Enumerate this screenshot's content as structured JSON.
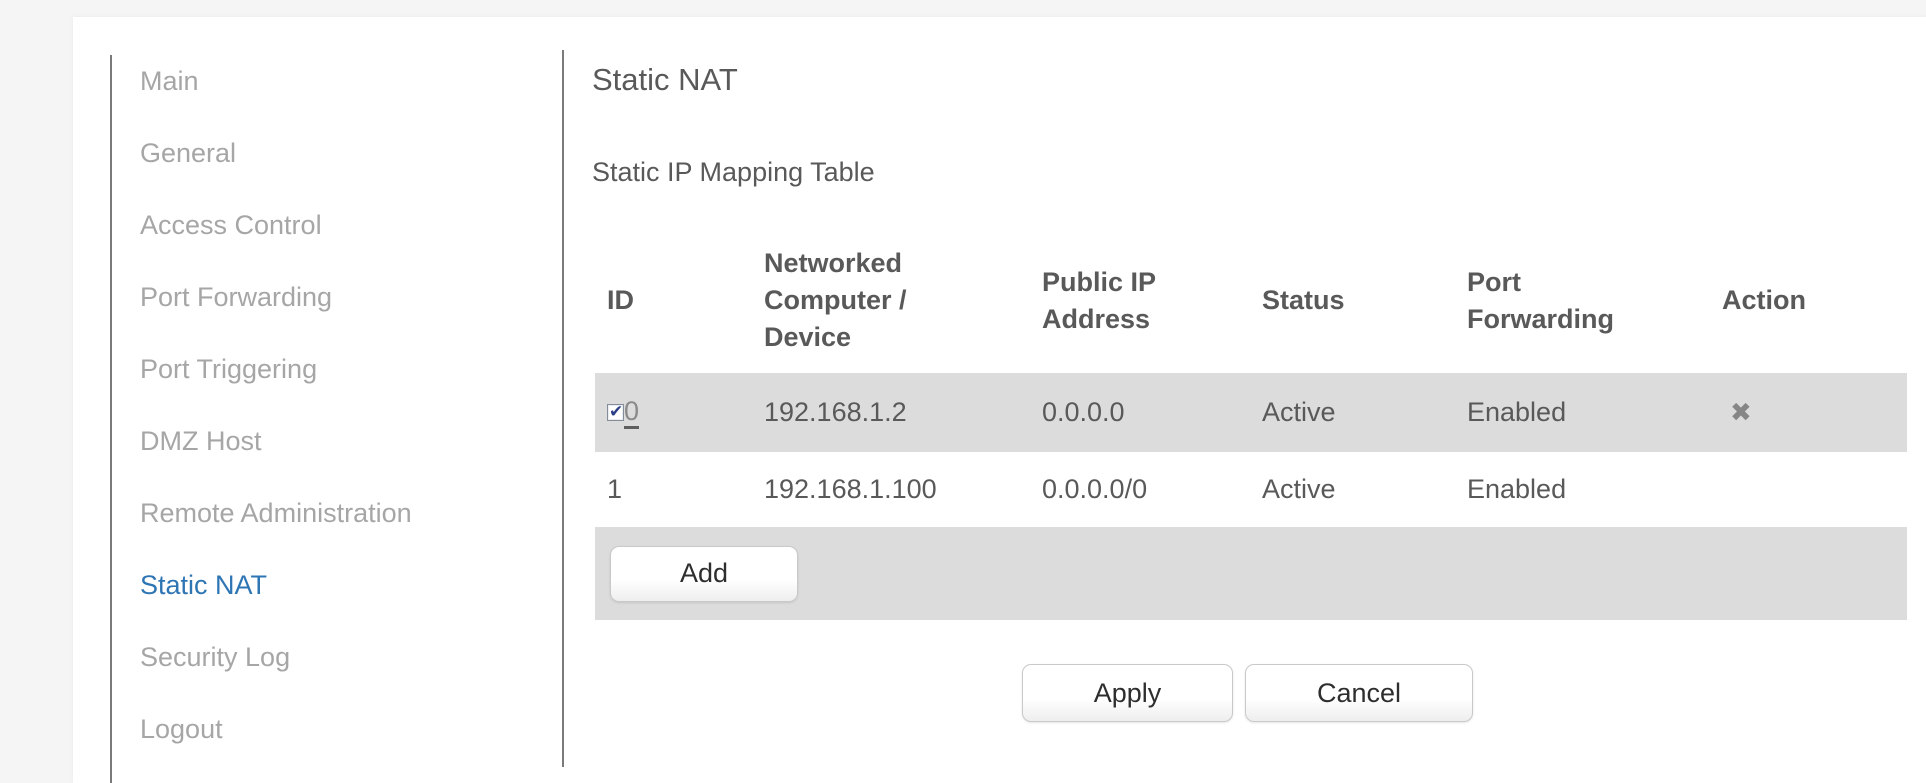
{
  "page": {
    "title": "Static NAT",
    "subtitle": "Static IP Mapping Table"
  },
  "sidebar": {
    "items": [
      {
        "label": "Main",
        "active": false
      },
      {
        "label": "General",
        "active": false
      },
      {
        "label": "Access Control",
        "active": false
      },
      {
        "label": "Port Forwarding",
        "active": false
      },
      {
        "label": "Port Triggering",
        "active": false
      },
      {
        "label": "DMZ Host",
        "active": false
      },
      {
        "label": "Remote Administration",
        "active": false
      },
      {
        "label": "Static NAT",
        "active": true
      },
      {
        "label": "Security Log",
        "active": false
      },
      {
        "label": "Logout",
        "active": false
      }
    ]
  },
  "table": {
    "headers": {
      "id": "ID",
      "device": "Networked\nComputer /\nDevice",
      "public_ip": "Public IP\nAddress",
      "status": "Status",
      "port_forwarding": "Port\nForwarding",
      "action": "Action"
    },
    "rows": [
      {
        "id": "0",
        "checkbox_checked": true,
        "device": "192.168.1.2",
        "public_ip": "0.0.0.0",
        "status": "Active",
        "port_forwarding": "Enabled",
        "action": "delete"
      },
      {
        "id": "1",
        "checkbox_checked": false,
        "device": "192.168.1.100",
        "public_ip": "0.0.0.0/0",
        "status": "Active",
        "port_forwarding": "Enabled",
        "action": ""
      }
    ]
  },
  "buttons": {
    "add": "Add",
    "apply": "Apply",
    "cancel": "Cancel"
  },
  "icons": {
    "checkbox_check": "✔",
    "delete_x": "✖"
  },
  "colors": {
    "active_link": "#2e75b4",
    "row_band": "#dcdcdc",
    "text": "#595959",
    "sidebar_text": "#a6a6a6"
  }
}
